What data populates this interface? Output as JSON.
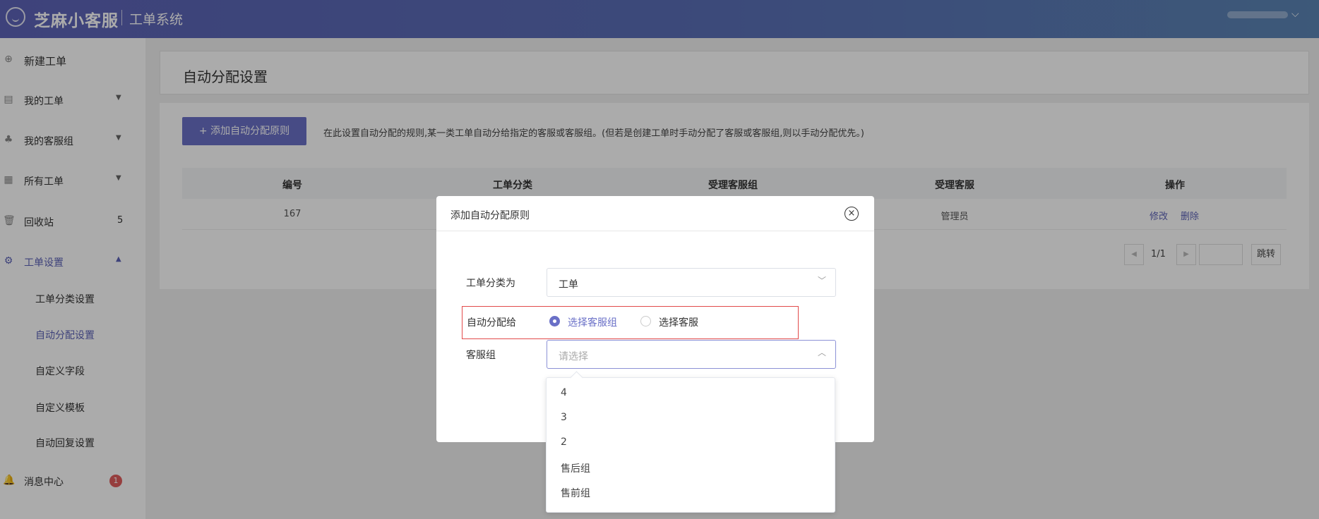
{
  "header": {
    "brand": "芝麻小客服",
    "subtitle": "工单系统",
    "user_caret": "⌵"
  },
  "sidebar": {
    "new_ticket": "新建工单",
    "items": [
      {
        "label": "我的工单",
        "arrow": "▼"
      },
      {
        "label": "我的客服组",
        "arrow": "▼"
      },
      {
        "label": "所有工单",
        "arrow": "▼"
      },
      {
        "label": "回收站",
        "count": "5"
      },
      {
        "label": "工单设置",
        "arrow": "▲"
      }
    ],
    "sub_items": [
      "工单分类设置",
      "自动分配设置",
      "自定义字段",
      "自定义模板",
      "自动回复设置"
    ],
    "message_center": "消息中心",
    "message_badge": "1"
  },
  "page": {
    "title": "自动分配设置",
    "add_button": "+ 添加自动分配原则",
    "hint": "在此设置自动分配的规则,某一类工单自动分给指定的客服或客服组。(但若是创建工单时手动分配了客服或客服组,则以手动分配优先。)",
    "table": {
      "headers": [
        "编号",
        "工单分类",
        "受理客服组",
        "受理客服",
        "操作"
      ],
      "rows": [
        {
          "id": "167",
          "agent": "管理员",
          "edit": "修改",
          "delete": "删除"
        }
      ]
    },
    "pager": {
      "prev": "◀",
      "page": "1/1",
      "next": "▶",
      "go": "跳转"
    }
  },
  "modal": {
    "title": "添加自动分配原则",
    "close": "×",
    "category_label": "工单分类为",
    "category_value": "工单",
    "assign_label": "自动分配给",
    "radio_group": "选择客服组",
    "radio_agent": "选择客服",
    "group_label": "客服组",
    "group_placeholder": "请选择",
    "caret_down": "﹀",
    "caret_up": "︿"
  },
  "dropdown": {
    "options": [
      "4",
      "3",
      "2",
      "售后组",
      "售前组"
    ]
  },
  "colors": {
    "accent": "#5d63b8",
    "danger": "#e24a4a"
  }
}
